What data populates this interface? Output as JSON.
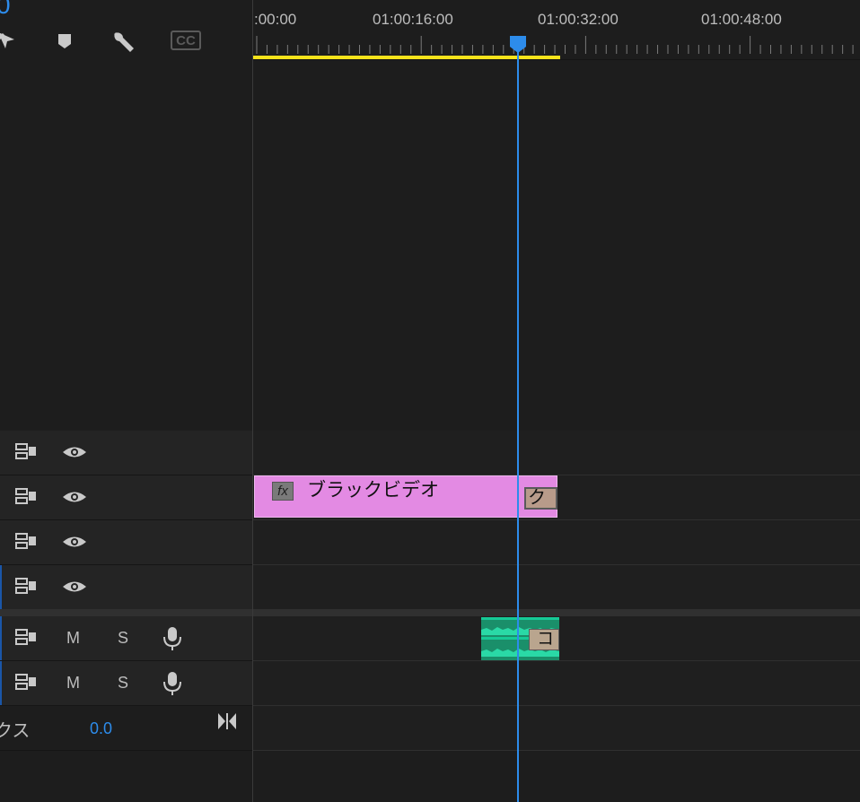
{
  "timecode": "0",
  "toolbar": {
    "tools": [
      "snap-icon",
      "marker-icon",
      "wrench-icon",
      "captions-icon"
    ],
    "captions_label": "CC"
  },
  "ruler": {
    "labels": [
      ":00:00",
      "01:00:16:00",
      "01:00:32:00",
      "01:00:48:00"
    ]
  },
  "video_tracks": [
    {
      "sync_lock": "sync-lock-icon",
      "visibility": "eye-icon"
    },
    {
      "sync_lock": "sync-lock-icon",
      "visibility": "eye-icon"
    },
    {
      "sync_lock": "sync-lock-icon",
      "visibility": "eye-icon"
    },
    {
      "sync_lock": "sync-lock-icon",
      "visibility": "eye-icon"
    }
  ],
  "audio_tracks": [
    {
      "mute_label": "M",
      "solo_label": "S",
      "voice": "microphone-icon"
    },
    {
      "mute_label": "M",
      "solo_label": "S",
      "voice": "microphone-icon"
    }
  ],
  "clips": {
    "video_fx_badge": "fx",
    "video_clip_name": "ブラックビデオ",
    "video_transition_label": "クロ",
    "audio_transition_label": "コ"
  },
  "mix": {
    "label": "クス",
    "value": "0.0"
  },
  "colors": {
    "playhead": "#2d8ceb",
    "work_area": "#f7e31b",
    "video_clip": "#e38ae3",
    "audio_clip": "#1a8f6a",
    "transition": "#b89b8a"
  }
}
